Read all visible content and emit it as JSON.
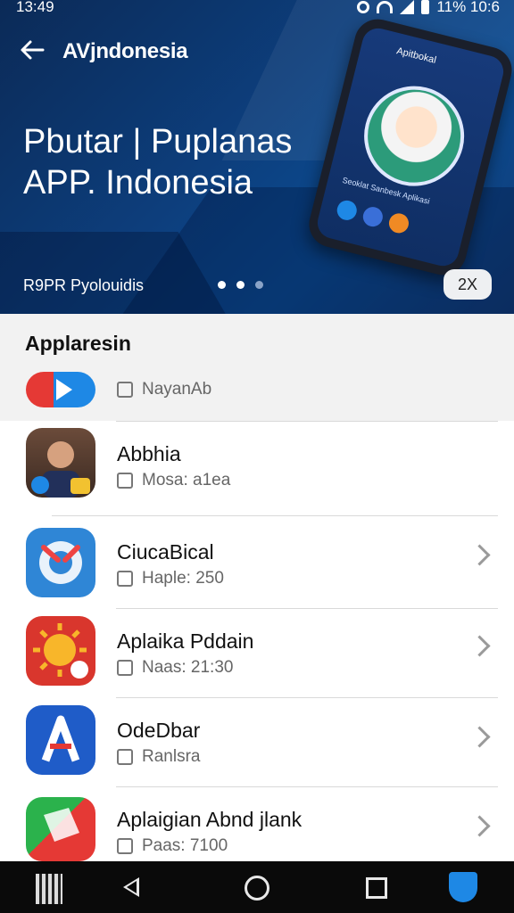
{
  "status_bar": {
    "time": "13:49",
    "battery_text": "11% 10:6"
  },
  "header": {
    "title": "AVjndonesia"
  },
  "hero": {
    "headline_line1": "Pbutar | Puplanas",
    "headline_line2": "APP. Indonesia",
    "promo_label": "R9PR Pyolouidis",
    "chip_text": "2X",
    "phone_app_title": "Apitbokal",
    "phone_caption": "Seoklat Sanbesk Aplikasi",
    "active_dot_count": 2,
    "total_dots": 3
  },
  "section": {
    "title": "Applaresin"
  },
  "apps": [
    {
      "name": "",
      "subtitle": "NayanAb",
      "icon": "play-store-icon",
      "show_chevron": false
    },
    {
      "name": "Abbhia",
      "subtitle": "Mosa: a1ea",
      "icon": "person-avatar-icon",
      "show_chevron": false
    },
    {
      "name": "CiucaBical",
      "subtitle": "Haple: 250",
      "icon": "quicktime-icon",
      "show_chevron": true
    },
    {
      "name": "Aplaika Pddain",
      "subtitle": "Naas: 21:30",
      "icon": "sun-icon",
      "show_chevron": true
    },
    {
      "name": "OdeDbar",
      "subtitle": "Ranlsra",
      "icon": "letter-a-icon",
      "show_chevron": true
    },
    {
      "name": "Aplaigian Abnd jlank",
      "subtitle": "Paas: 7100",
      "icon": "cube-icon",
      "show_chevron": true
    }
  ],
  "nav": {
    "items": [
      "calendar-grid-icon",
      "back-triangle-icon",
      "home-circle-icon",
      "recents-square-icon",
      "shield-icon"
    ]
  },
  "colors": {
    "hero_bg": "#0d3e7c",
    "accent": "#1e88e5",
    "navbar_bg": "#0a0a0a"
  }
}
